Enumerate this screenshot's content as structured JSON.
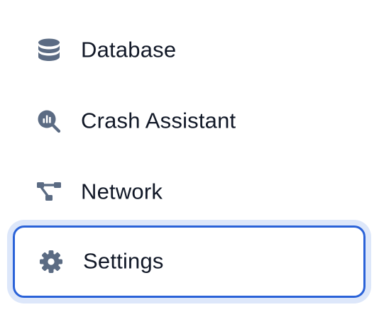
{
  "nav": {
    "items": [
      {
        "label": "Database",
        "icon": "database-icon"
      },
      {
        "label": "Crash Assistant",
        "icon": "crash-search-icon"
      },
      {
        "label": "Network",
        "icon": "network-icon"
      },
      {
        "label": "Settings",
        "icon": "gear-icon",
        "focused": true
      }
    ]
  },
  "colors": {
    "icon": "#5b6b83",
    "text": "#111827",
    "focus_border": "#2a62d8",
    "focus_ring": "#dde7fa"
  }
}
